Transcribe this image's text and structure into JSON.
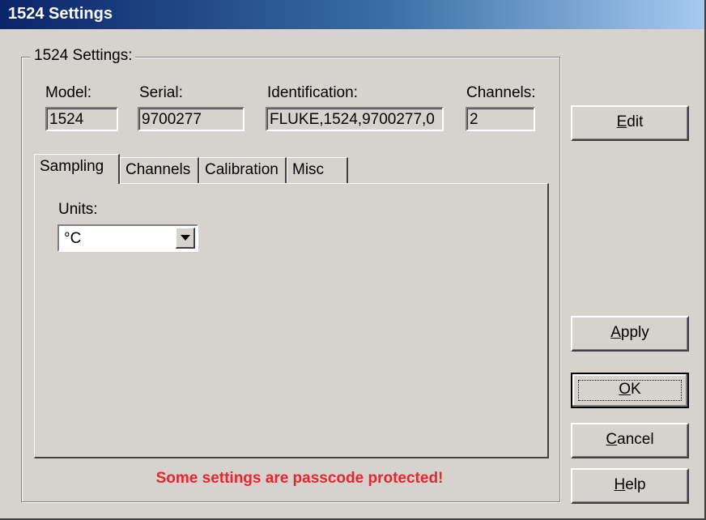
{
  "window": {
    "title": "1524 Settings"
  },
  "group": {
    "label": "1524 Settings:"
  },
  "fields": {
    "model": {
      "label": "Model:",
      "value": "1524"
    },
    "serial": {
      "label": "Serial:",
      "value": "9700277"
    },
    "identification": {
      "label": "Identification:",
      "value": "FLUKE,1524,9700277,0"
    },
    "channels": {
      "label": "Channels:",
      "value": "2"
    }
  },
  "tabs": [
    {
      "label": "Sampling",
      "active": true
    },
    {
      "label": "Channels",
      "active": false
    },
    {
      "label": "Calibration",
      "active": false
    },
    {
      "label": "Misc",
      "active": false
    }
  ],
  "sampling": {
    "units_label": "Units:",
    "units_value": "°C"
  },
  "buttons": {
    "edit": {
      "label": "Edit",
      "mnemonic": "E",
      "rest": "dit"
    },
    "apply": {
      "label": "Apply",
      "mnemonic": "A",
      "rest": "pply"
    },
    "ok": {
      "label": "OK",
      "mnemonic": "O",
      "rest": "K"
    },
    "cancel": {
      "label": "Cancel",
      "mnemonic": "C",
      "rest": "ancel"
    },
    "help": {
      "label": "Help",
      "mnemonic": "H",
      "rest": "elp"
    }
  },
  "warning": {
    "text": "Some settings are passcode protected!",
    "color": "#e8262d"
  },
  "colors": {
    "titlebar_start": "#0a246a",
    "titlebar_end": "#a6caf0",
    "face": "#d6d3ce"
  }
}
